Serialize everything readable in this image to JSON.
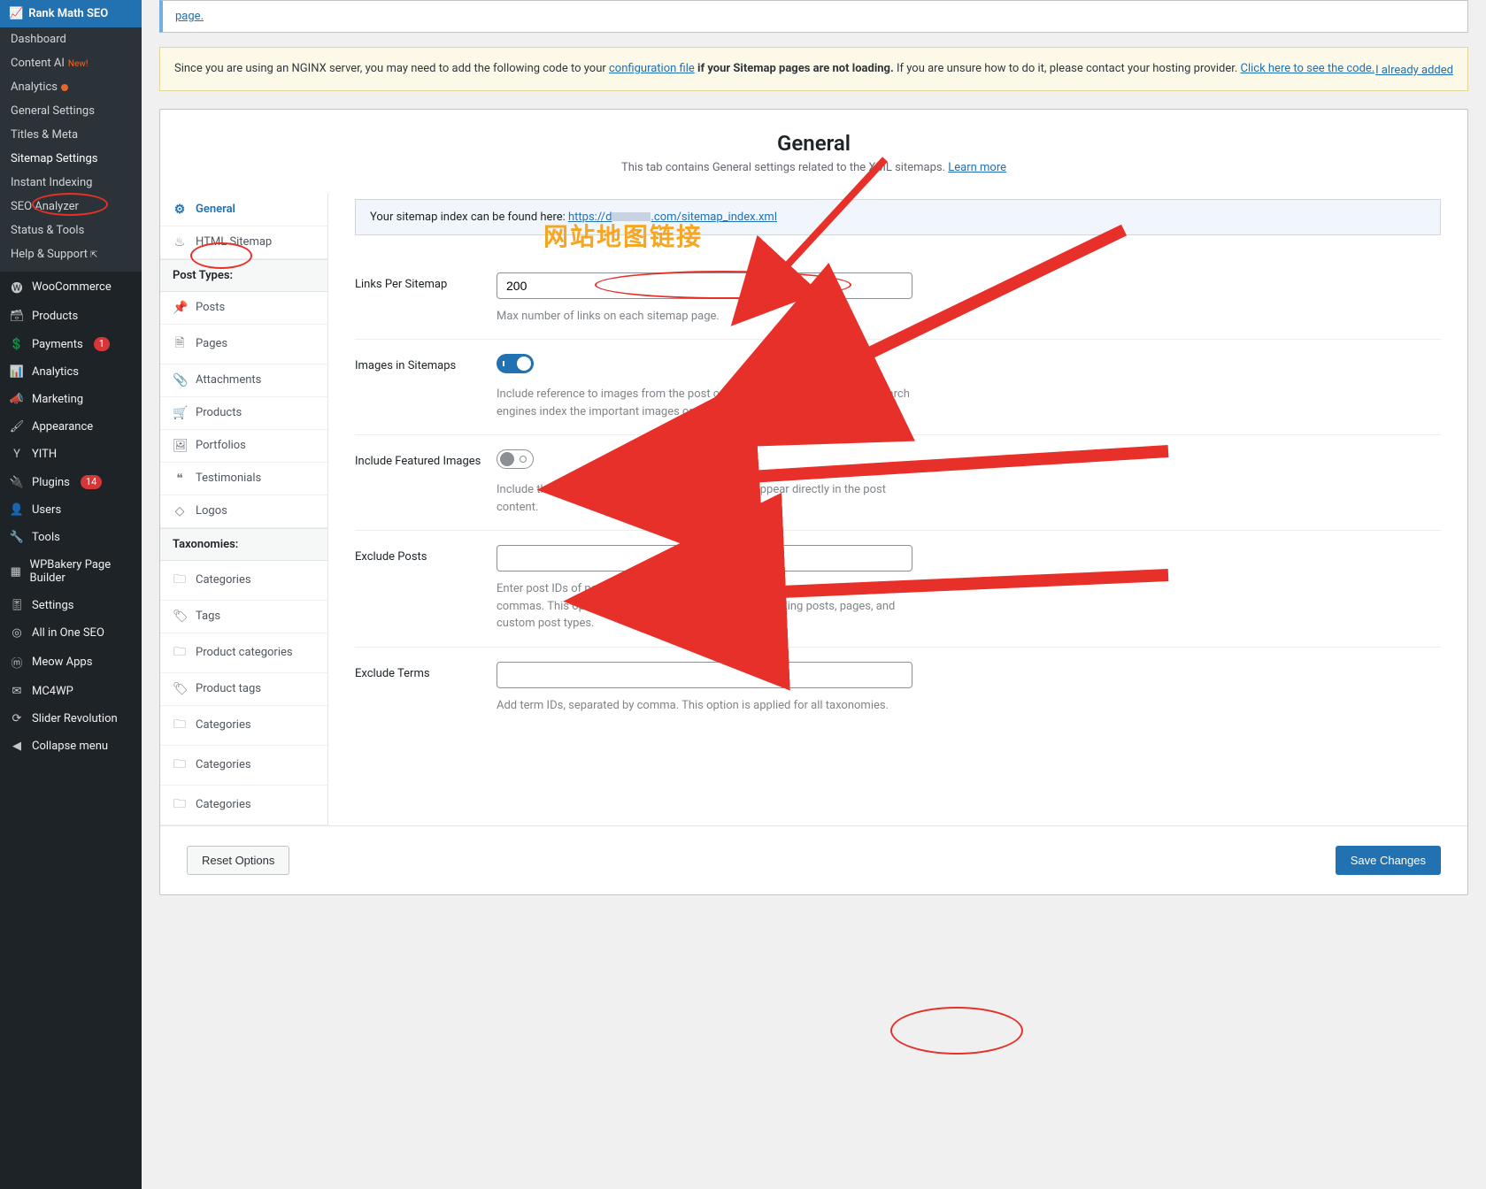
{
  "sidebar": {
    "plugin_header": "Rank Math SEO",
    "subitems": [
      {
        "label": "Dashboard"
      },
      {
        "label": "Content AI",
        "new": true,
        "new_label": "New!"
      },
      {
        "label": "Analytics",
        "dot": true
      },
      {
        "label": "General Settings"
      },
      {
        "label": "Titles & Meta"
      },
      {
        "label": "Sitemap Settings",
        "active": true
      },
      {
        "label": "Instant Indexing"
      },
      {
        "label": "SEO Analyzer"
      },
      {
        "label": "Status & Tools"
      },
      {
        "label": "Help & Support",
        "ext": true
      }
    ],
    "mainitems": [
      {
        "label": "WooCommerce",
        "icon": "woo"
      },
      {
        "label": "Products",
        "icon": "box"
      },
      {
        "label": "Payments",
        "icon": "card",
        "count": "1"
      },
      {
        "label": "Analytics",
        "icon": "chart"
      },
      {
        "label": "Marketing",
        "icon": "megaphone"
      },
      {
        "label": "Appearance",
        "icon": "brush"
      },
      {
        "label": "YITH",
        "icon": "y"
      },
      {
        "label": "Plugins",
        "icon": "plug",
        "count": "14"
      },
      {
        "label": "Users",
        "icon": "user"
      },
      {
        "label": "Tools",
        "icon": "wrench"
      },
      {
        "label": "WPBakery Page Builder",
        "icon": "grid"
      },
      {
        "label": "Settings",
        "icon": "sliders"
      },
      {
        "label": "All in One SEO",
        "icon": "aio"
      },
      {
        "label": "Meow Apps",
        "icon": "m"
      },
      {
        "label": "MC4WP",
        "icon": "mc"
      },
      {
        "label": "Slider Revolution",
        "icon": "refresh"
      },
      {
        "label": "Collapse menu",
        "icon": "collapse"
      }
    ]
  },
  "top_notice_fragment": "page.",
  "nginx_notice": {
    "prefix": "Since you are using an NGINX server, you may need to add the following code to your ",
    "config_link": "configuration file",
    "mid1": " ",
    "bold1": "if your Sitemap pages are not loading.",
    "mid2": " If you are unsure how to do it, please contact your hosting provider. ",
    "code_link": "Click here to see the code.",
    "already": "I already added"
  },
  "panel": {
    "title": "General",
    "desc_prefix": "This tab contains General settings related to the XML sitemaps. ",
    "learn_more": "Learn more",
    "tabs": {
      "general": "General",
      "html_sitemap": "HTML Sitemap",
      "group_post_types": "Post Types:",
      "posts": "Posts",
      "pages": "Pages",
      "attachments": "Attachments",
      "products": "Products",
      "portfolios": "Portfolios",
      "testimonials": "Testimonials",
      "logos": "Logos",
      "group_taxonomies": "Taxonomies:",
      "categories": "Categories",
      "tags": "Tags",
      "product_categories": "Product categories",
      "product_tags": "Product tags",
      "categories2": "Categories",
      "categories3": "Categories",
      "categories4": "Categories"
    },
    "info_banner_prefix": "Your sitemap index can be found here: ",
    "info_banner_link_part1": "https://d",
    "info_banner_link_part2": ".com/sitemap_index.xml",
    "fields": {
      "links_per_sitemap": {
        "label": "Links Per Sitemap",
        "value": "200",
        "help": "Max number of links on each sitemap page."
      },
      "images_in_sitemaps": {
        "label": "Images in Sitemaps",
        "help": "Include reference to images from the post content in sitemaps. This helps search engines index the important images on your pages."
      },
      "include_featured_images": {
        "label": "Include Featured Images",
        "help": "Include the Featured Image too, even if it does not appear directly in the post content."
      },
      "exclude_posts": {
        "label": "Exclude Posts",
        "help": "Enter post IDs of posts you want to exclude from the sitemap, separated by commas. This option **applies** to all posts types including posts, pages, and custom post types."
      },
      "exclude_terms": {
        "label": "Exclude Terms",
        "help": "Add term IDs, separated by comma. This option is applied for all taxonomies."
      }
    },
    "buttons": {
      "reset": "Reset Options",
      "save": "Save Changes"
    }
  },
  "annotations": {
    "sitemap_link_label": "网站地图链接"
  }
}
